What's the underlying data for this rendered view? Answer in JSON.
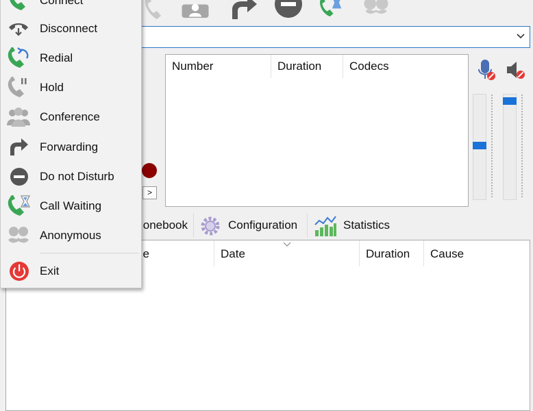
{
  "menu": {
    "items": [
      {
        "label": "Connect",
        "icon": "connect-icon"
      },
      {
        "label": "Disconnect",
        "icon": "disconnect-icon"
      },
      {
        "label": "Redial",
        "icon": "redial-icon"
      },
      {
        "label": "Hold",
        "icon": "hold-icon"
      },
      {
        "label": "Conference",
        "icon": "conference-icon"
      },
      {
        "label": "Forwarding",
        "icon": "forwarding-icon"
      },
      {
        "label": "Do not Disturb",
        "icon": "do-not-disturb-icon"
      },
      {
        "label": "Call Waiting",
        "icon": "call-waiting-icon"
      },
      {
        "label": "Anonymous",
        "icon": "anonymous-icon"
      }
    ],
    "exit_label": "Exit"
  },
  "calls": {
    "columns": [
      "Number",
      "Duration",
      "Codecs"
    ]
  },
  "nav": {
    "next": ">"
  },
  "volume": {
    "mic_level": 0.52,
    "speaker_level": 0.97
  },
  "tabs": {
    "phonebook": "onebook",
    "configuration": "Configuration",
    "statistics": "Statistics"
  },
  "log": {
    "columns": [
      "e",
      "Date",
      "Duration",
      "Cause"
    ],
    "sort_indicator": "Date"
  },
  "colors": {
    "accent": "#1a73d9",
    "record": "#8b0000",
    "exit": "#e53935",
    "phone_green": "#3aa655"
  }
}
